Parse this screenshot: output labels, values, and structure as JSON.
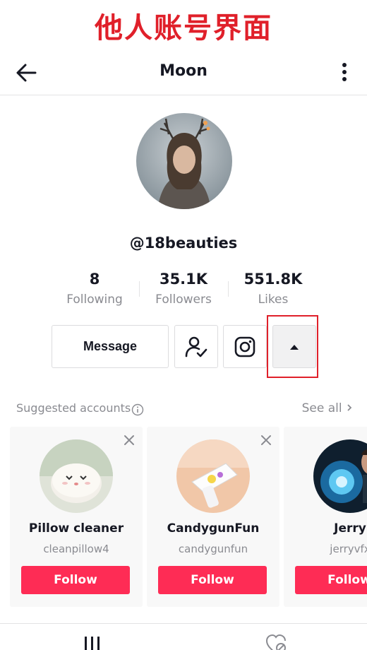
{
  "banner": {
    "title": "他人账号界面"
  },
  "nav": {
    "title": "Moon",
    "back_icon": "back-arrow-icon",
    "more_icon": "more-vertical-icon"
  },
  "profile": {
    "username": "@18beauties",
    "stats": [
      {
        "value": "8",
        "label": "Following"
      },
      {
        "value": "35.1K",
        "label": "Followers"
      },
      {
        "value": "551.8K",
        "label": "Likes"
      }
    ]
  },
  "actions": {
    "message_label": "Message",
    "friend_icon": "user-check-icon",
    "instagram_icon": "instagram-icon",
    "more_icon": "caret-up-icon"
  },
  "suggested": {
    "title": "Suggested accounts",
    "see_all": "See all",
    "accounts": [
      {
        "name": "Pillow cleaner",
        "handle": "cleanpillow4",
        "follow_label": "Follow"
      },
      {
        "name": "CandygunFun",
        "handle": "candygunfun",
        "follow_label": "Follow"
      },
      {
        "name": "Jerry",
        "handle": "jerryvfx",
        "follow_label": "Follow"
      }
    ]
  },
  "tabs": {
    "videos_icon": "grid-icon",
    "liked_icon": "hidden-heart-icon"
  },
  "colors": {
    "accent": "#fe2c55",
    "banner": "#e0202a",
    "secondary_text": "#8a8b91"
  }
}
